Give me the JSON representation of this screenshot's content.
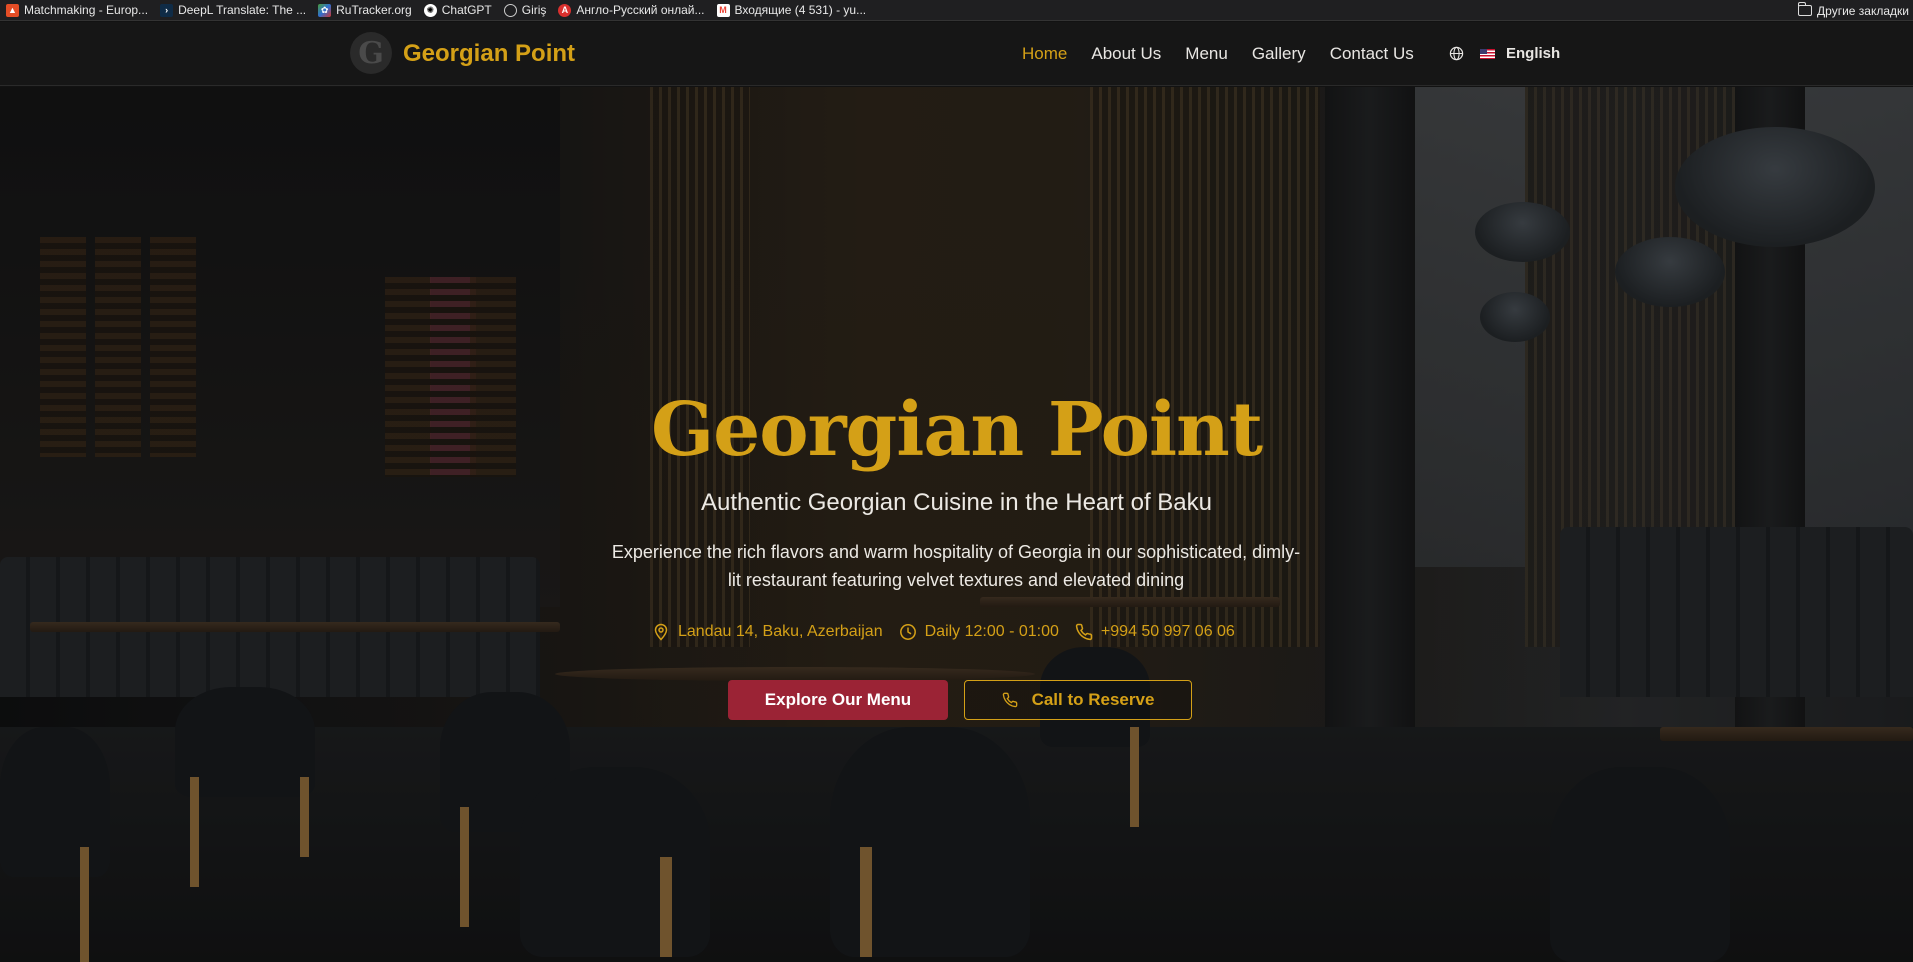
{
  "bookmarks": {
    "items": [
      {
        "label": "Matchmaking - Europ...",
        "icon": "matchmaking-icon",
        "color": "#e44d26"
      },
      {
        "label": "DeepL Translate: The ...",
        "icon": "deepl-icon",
        "color": "#0f2b46"
      },
      {
        "label": "RuTracker.org",
        "icon": "rutracker-icon",
        "color": "#4a9d3a"
      },
      {
        "label": "ChatGPT",
        "icon": "chatgpt-icon",
        "color": "#ffffff"
      },
      {
        "label": "Giriş",
        "icon": "globe-icon",
        "color": "#cccccc"
      },
      {
        "label": "Англо-Русский онлай...",
        "icon": "translate-icon",
        "color": "#d9302e"
      },
      {
        "label": "Входящие (4 531) - yu...",
        "icon": "gmail-icon",
        "color": "#ea4335"
      }
    ],
    "other": "Другие закладки"
  },
  "nav": {
    "logo_letter": "G",
    "brand": "Georgian Point",
    "links": [
      "Home",
      "About Us",
      "Menu",
      "Gallery",
      "Contact Us"
    ],
    "active": "Home",
    "language": "English"
  },
  "hero": {
    "title": "Georgian Point",
    "subtitle": "Authentic Georgian Cuisine in the Heart of Baku",
    "description": "Experience the rich flavors and warm hospitality of Georgia in our sophisticated, dimly-lit restaurant featuring velvet textures and elevated dining",
    "address": "Landau 14, Baku, Azerbaijan",
    "hours": "Daily 12:00 - 01:00",
    "phone": "+994 50 997 06 06",
    "primary_button": "Explore Our Menu",
    "secondary_button": "Call to Reserve"
  },
  "colors": {
    "accent_gold": "#d4a017",
    "primary_red": "#9b2335",
    "nav_bg": "#161616"
  }
}
